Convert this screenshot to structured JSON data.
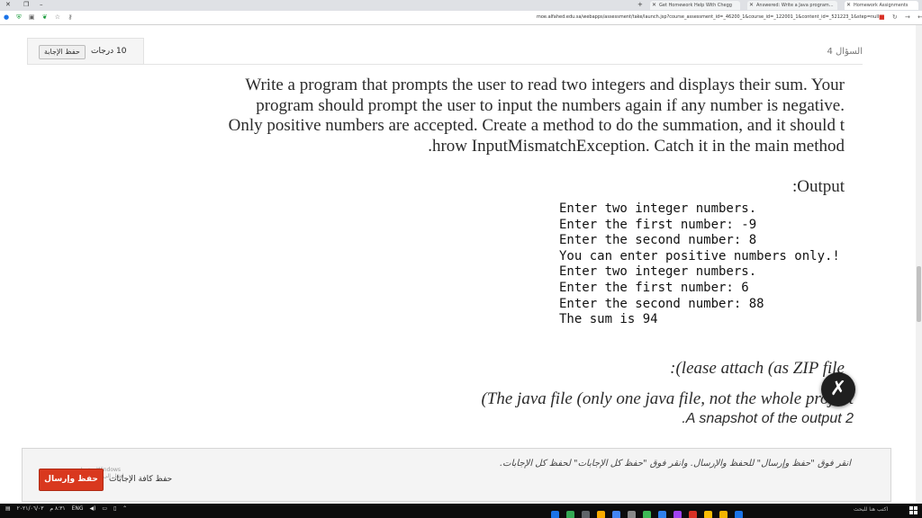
{
  "browser": {
    "tabs": [
      {
        "label": "Get Homework Help With Chegg"
      },
      {
        "label": "Answered: Write a Java program..."
      },
      {
        "label": "Homework Assignments"
      }
    ],
    "url": "moe.alfahed.edu.sa/webapps/assessment/take/launch.jsp?course_assessment_id=_46200_1&course_id=_122001_1&content_id=_521223_1&step=null",
    "icons_left": [
      "circle-icon",
      "shield-icon",
      "box-icon",
      "leaf-icon",
      "star-icon",
      "key-icon"
    ],
    "icons_right": [
      "bookmark-icon",
      "refresh-icon",
      "forward-icon",
      "back-icon"
    ]
  },
  "question": {
    "save_answer_label": "حفظ الإجابة",
    "points": "10 درجات",
    "label": "السؤال 4",
    "lines": [
      "Write a program that prompts the user to read two integers and displays their sum. Your",
      "program should prompt the user to input the numbers again if any number is negative.",
      "Only positive numbers are accepted. Create a method to do the summation, and it should t",
      ".hrow InputMismatchException. Catch it in the main method"
    ],
    "output_label": ":Output",
    "output_lines": [
      "Enter two integer numbers.",
      "Enter the first number: -9",
      "Enter the second number: 8",
      "You can enter positive numbers only.!",
      "Enter two integer numbers.",
      "Enter the first number: 6",
      "Enter the second number: 88",
      "The sum is 94"
    ],
    "attach_1": ":(lease attach (as ZIP file",
    "attach_2": "(The java file (only one java file, not the whole project",
    "attach_3": ".A snapshot of the output 2"
  },
  "footer": {
    "hint": "انقر فوق \"حفظ وإرسال\" للحفظ والإرسال. وانقر فوق \"حفظ كل الإجابات\" لحفظ كل الإجابات.",
    "save_all_label": "حفظ كافة الإجابات",
    "submit_label": "حفظ وإرسال",
    "watermark_1": "تنشيط Windows",
    "watermark_2": "انتقل إلى الإعدادات"
  },
  "taskbar": {
    "clock": "٨:٣١ م",
    "date": "٢٠٢١/٠٦/٠٣",
    "lang": "ENG",
    "search_placeholder": "اكتب هنا للبحث",
    "apps": [
      {
        "name": "dropbox-app-icon",
        "color": "#1a73e8"
      },
      {
        "name": "chrome-app-icon",
        "color": "#34a853"
      },
      {
        "name": "calculator-app-icon",
        "color": "#5f6368"
      },
      {
        "name": "folder-app-icon",
        "color": "#f9ab00"
      },
      {
        "name": "store-app-icon",
        "color": "#4285f4"
      },
      {
        "name": "settings-app-icon",
        "color": "#888888"
      },
      {
        "name": "phone-app-icon",
        "color": "#3cba54"
      },
      {
        "name": "mail-app-icon",
        "color": "#2f80ed"
      },
      {
        "name": "media-app-icon",
        "color": "#a142f4"
      },
      {
        "name": "red-app-icon",
        "color": "#d93025"
      },
      {
        "name": "chrome-active-app-icon",
        "color": "#fbbc04"
      },
      {
        "name": "files-app-icon",
        "color": "#f4b400"
      },
      {
        "name": "edge-app-icon",
        "color": "#1a73e8"
      }
    ]
  }
}
